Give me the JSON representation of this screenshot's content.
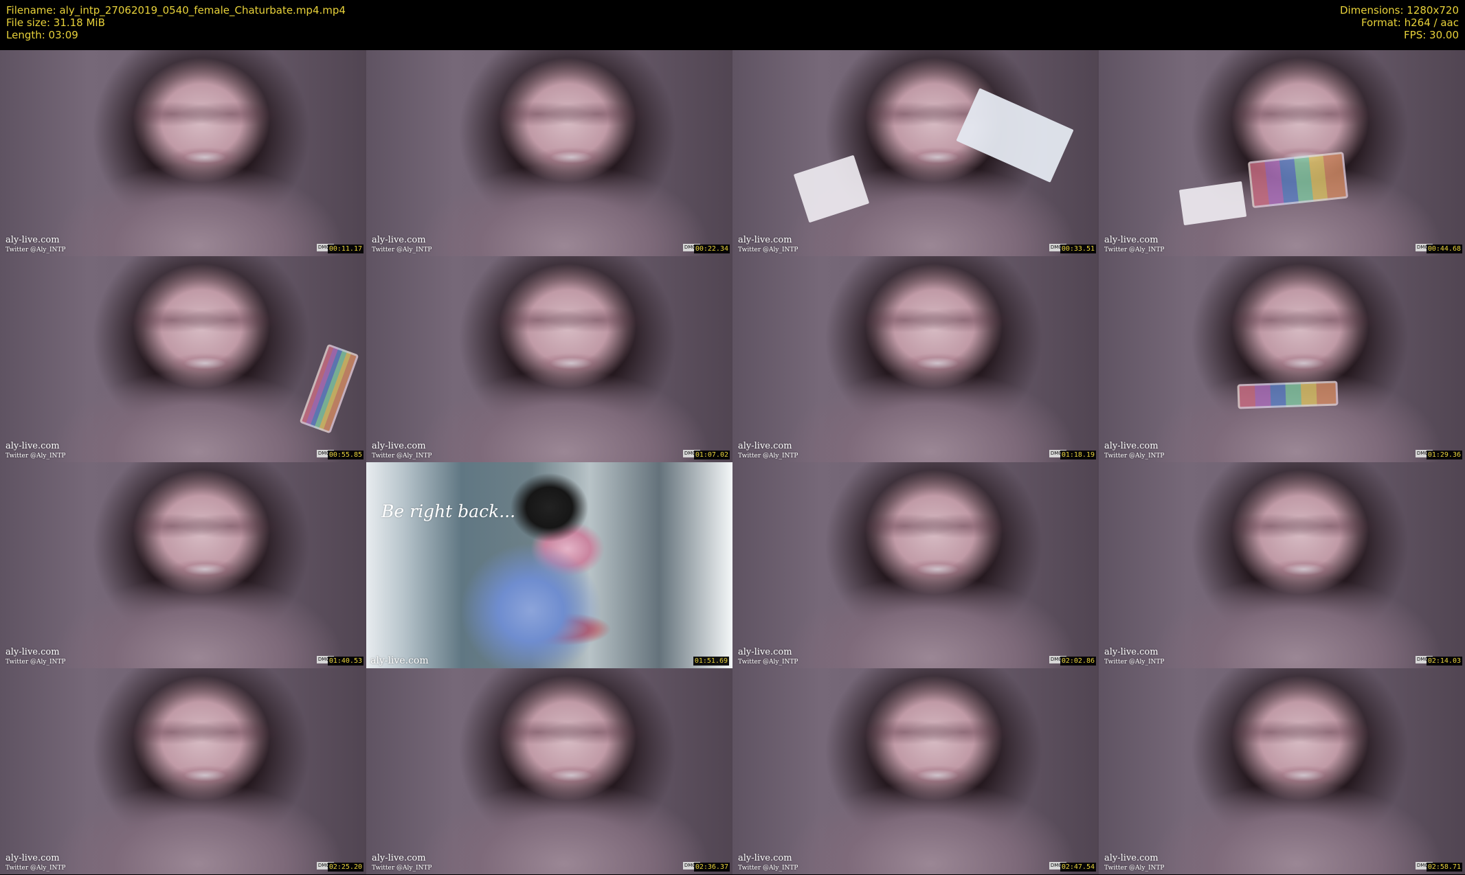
{
  "header": {
    "filename_label": "Filename: aly_intp_27062019_0540_female_Chaturbate.mp4.mp4",
    "file_size_label": "File size: 31.18 MiB",
    "length_label": "Length: 03:09",
    "dimensions_label": "Dimensions: 1280x720",
    "format_label": "Format: h264 / aac",
    "fps_label": "FPS: 30.00"
  },
  "thumbnails": [
    {
      "site": "aly-live.com",
      "twitter": "Twitter @Aly_INTP",
      "dmca": "DMCA",
      "time": "00:11.17"
    },
    {
      "site": "aly-live.com",
      "twitter": "Twitter @Aly_INTP",
      "dmca": "DMCA",
      "time": "00:22.34"
    },
    {
      "site": "aly-live.com",
      "twitter": "Twitter @Aly_INTP",
      "dmca": "DMCA",
      "time": "00:33.51"
    },
    {
      "site": "aly-live.com",
      "twitter": "Twitter @Aly_INTP",
      "dmca": "DMCA",
      "time": "00:44.68"
    },
    {
      "site": "aly-live.com",
      "twitter": "Twitter @Aly_INTP",
      "dmca": "DMCA",
      "time": "00:55.85"
    },
    {
      "site": "aly-live.com",
      "twitter": "Twitter @Aly_INTP",
      "dmca": "DMCA",
      "time": "01:07.02"
    },
    {
      "site": "aly-live.com",
      "twitter": "Twitter @Aly_INTP",
      "dmca": "DMCA",
      "time": "01:18.19"
    },
    {
      "site": "aly-live.com",
      "twitter": "Twitter @Aly_INTP",
      "dmca": "DMCA",
      "time": "01:29.36"
    },
    {
      "site": "aly-live.com",
      "twitter": "Twitter @Aly_INTP",
      "dmca": "DMCA",
      "time": "01:40.53"
    },
    {
      "site": "aly-live.com",
      "overlay": "Be right back...",
      "time": "01:51.69"
    },
    {
      "site": "aly-live.com",
      "twitter": "Twitter @Aly_INTP",
      "dmca": "DMCA",
      "time": "02:02.86"
    },
    {
      "site": "aly-live.com",
      "twitter": "Twitter @Aly_INTP",
      "dmca": "DMCA",
      "time": "02:14.03"
    },
    {
      "site": "aly-live.com",
      "twitter": "Twitter @Aly_INTP",
      "dmca": "DMCA",
      "time": "02:25.20"
    },
    {
      "site": "aly-live.com",
      "twitter": "Twitter @Aly_INTP",
      "dmca": "DMCA",
      "time": "02:36.37"
    },
    {
      "site": "aly-live.com",
      "twitter": "Twitter @Aly_INTP",
      "dmca": "DMCA",
      "time": "02:47.54"
    },
    {
      "site": "aly-live.com",
      "twitter": "Twitter @Aly_INTP",
      "dmca": "DMCA",
      "time": "02:58.71"
    }
  ]
}
